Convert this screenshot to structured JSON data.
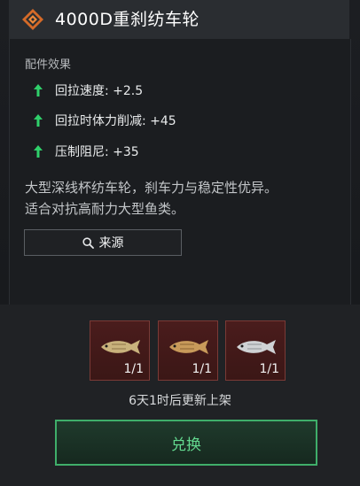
{
  "header": {
    "title": "4000D重刹纺车轮",
    "icon": "reel-emblem-icon",
    "icon_color": "#e07a2e"
  },
  "attributes": {
    "title": "配件效果",
    "items": [
      {
        "label": "回拉速度: +2.5",
        "icon": "up-arrow-icon",
        "color": "#2fd06a"
      },
      {
        "label": "回拉时体力削减: +45",
        "icon": "up-arrow-icon",
        "color": "#2fd06a"
      },
      {
        "label": "压制阻尼: +35",
        "icon": "up-arrow-icon",
        "color": "#2fd06a"
      }
    ]
  },
  "description": {
    "line1": "大型深线杯纺车轮，刹车力与稳定性优异。",
    "line2": "适合对抗高耐力大型鱼类。"
  },
  "source_button": {
    "label": "来源",
    "icon": "search-icon"
  },
  "costs": [
    {
      "name": "fish-1",
      "count": "1/1",
      "icon": "fish-icon"
    },
    {
      "name": "fish-2",
      "count": "1/1",
      "icon": "fish-icon"
    },
    {
      "name": "fish-3",
      "count": "1/1",
      "icon": "fish-icon"
    }
  ],
  "restock_text": "6天1时后更新上架",
  "exchange_button": {
    "label": "兑换",
    "accent": "#3fae6a"
  }
}
